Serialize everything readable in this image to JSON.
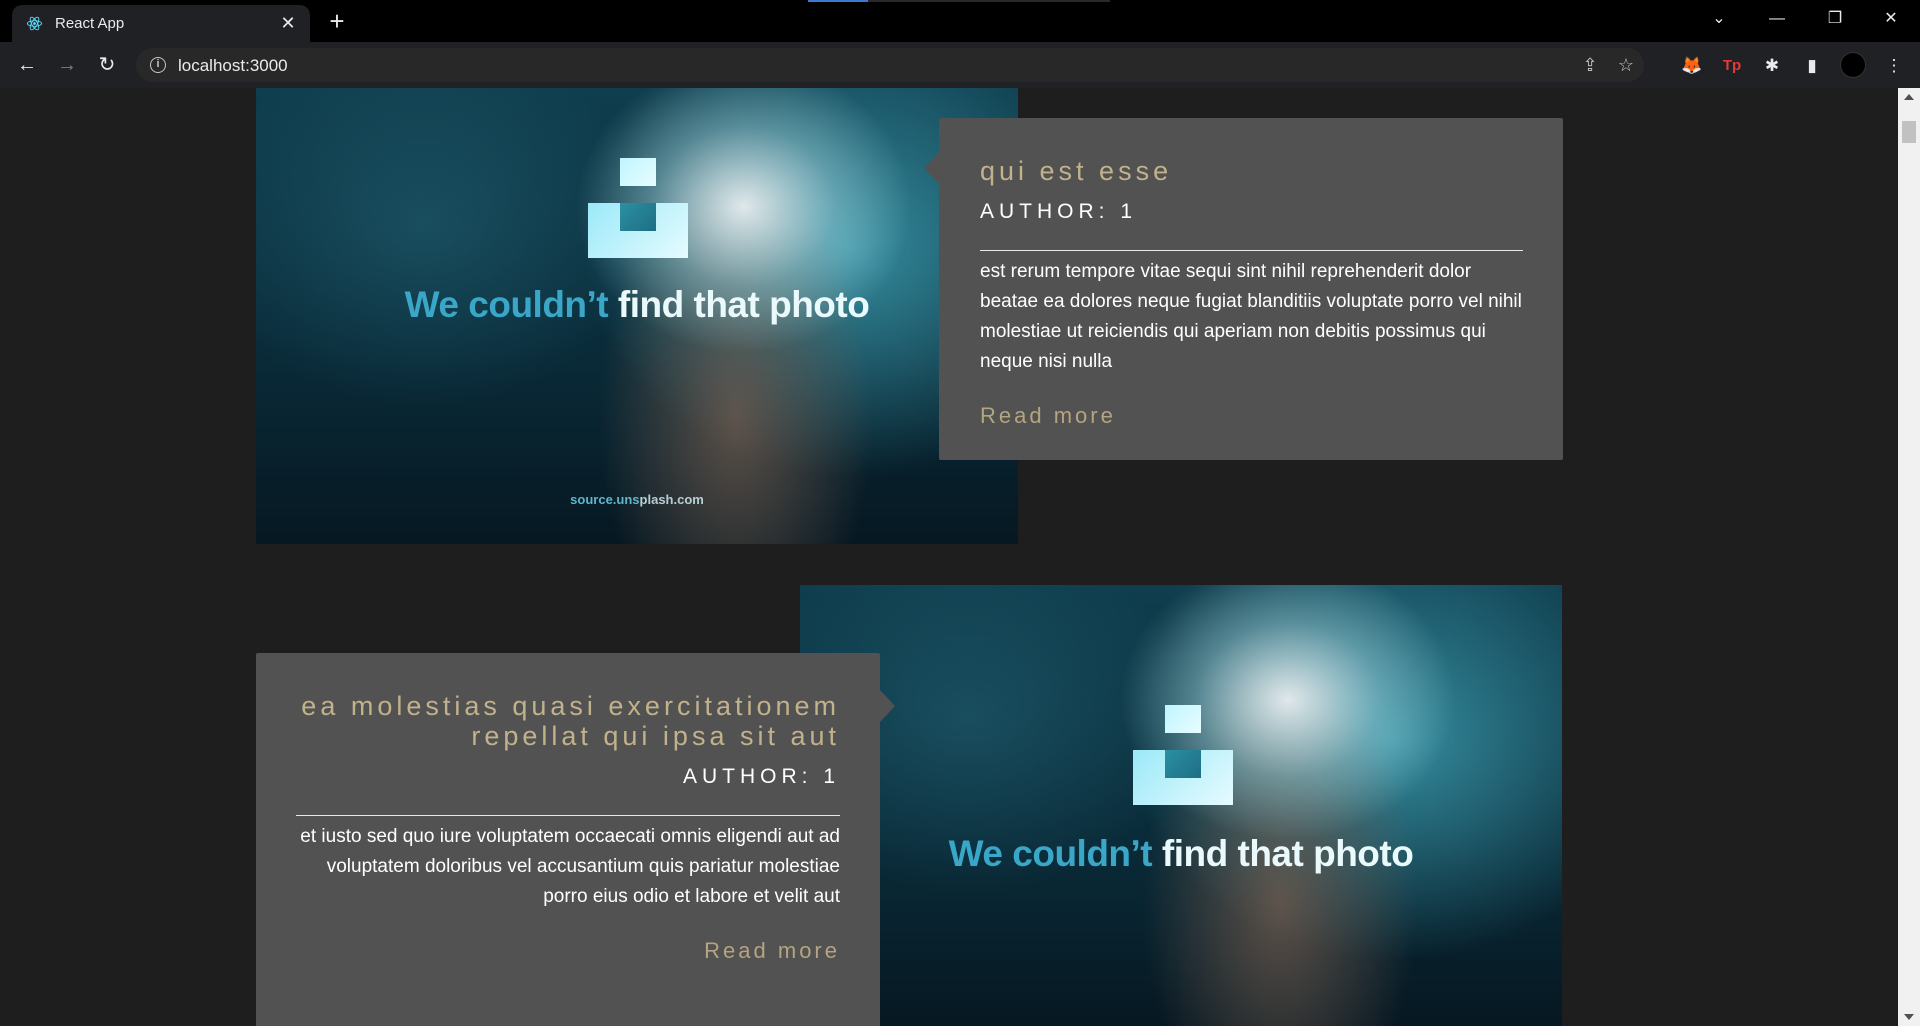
{
  "browser": {
    "tab_title": "React App",
    "url": "localhost:3000"
  },
  "posts": [
    {
      "title": "qui est esse",
      "author": "AUTHOR: 1",
      "body": "est rerum tempore vitae sequi sint nihil reprehenderit dolor beatae ea dolores neque fugiat blanditiis voluptate porro vel nihil molestiae ut reiciendis qui aperiam non debitis possimus qui neque nisi nulla",
      "read_more": "Read more",
      "image_message_part1": "We couldn’t",
      "image_message_part2": "find that photo",
      "image_source_part1": "source.uns",
      "image_source_part2": "plash.com"
    },
    {
      "title": "ea molestias quasi exercitationem repellat qui ipsa sit aut",
      "author": "AUTHOR: 1",
      "body": "et iusto sed quo iure voluptatem occaecati omnis eligendi aut ad voluptatem doloribus vel accusantium quis pariatur molestiae porro eius odio et labore et velit aut",
      "read_more": "Read more",
      "image_message_part1": "We couldn’t",
      "image_message_part2": "find that photo"
    }
  ],
  "colors": {
    "page_background": "#1f1e1f",
    "card_background": "#525252",
    "title_accent": "#c2b28b"
  }
}
